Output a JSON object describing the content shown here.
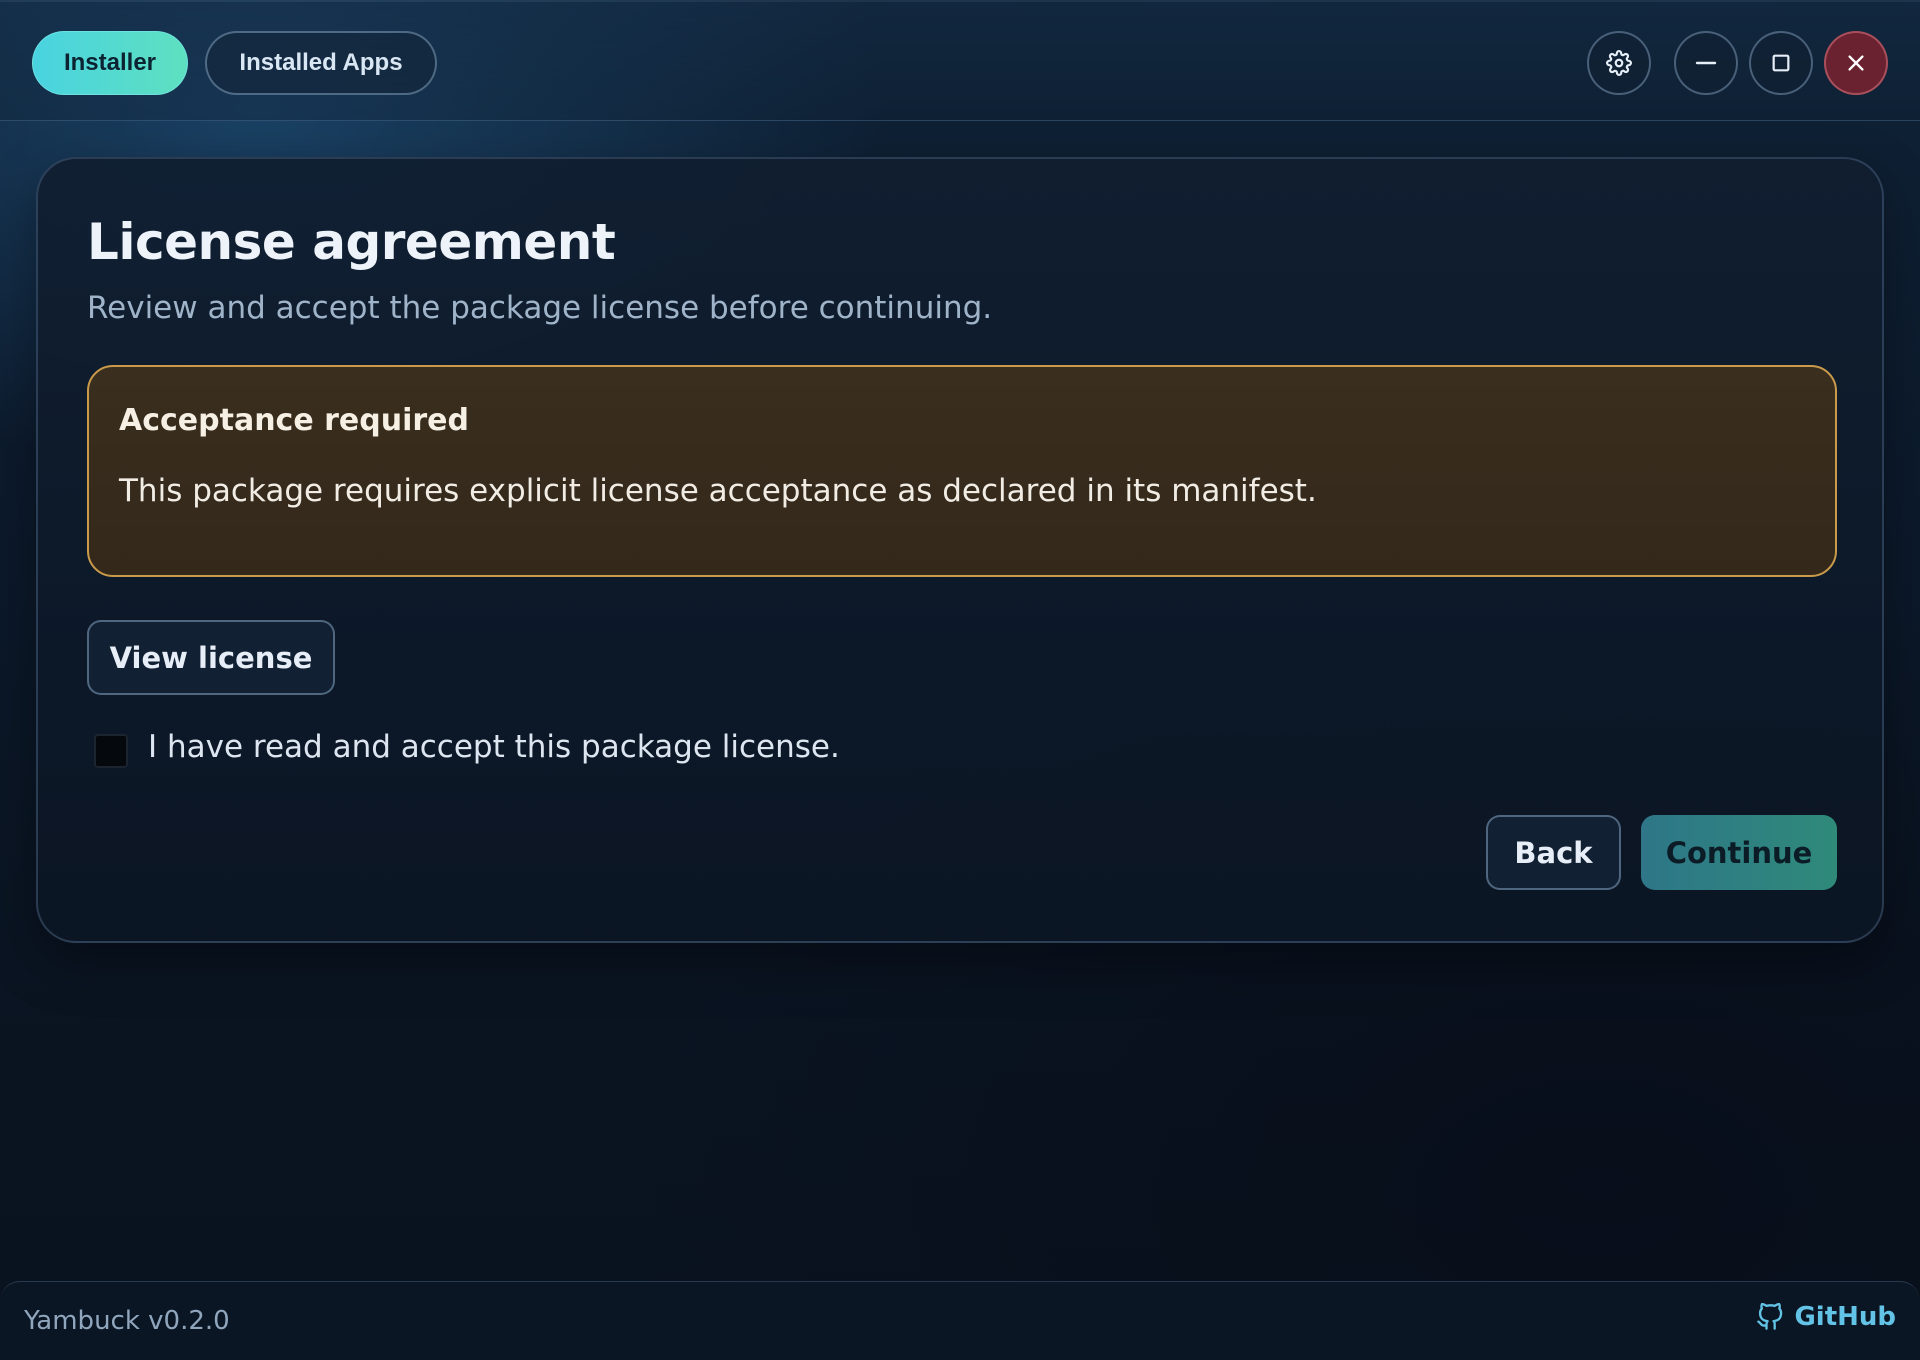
{
  "tabs": {
    "installer": "Installer",
    "installed_apps": "Installed Apps"
  },
  "window_controls": [
    "settings-icon",
    "minimize-icon",
    "maximize-icon",
    "close-icon"
  ],
  "page": {
    "title": "License agreement",
    "subtitle": "Review and accept the package license before continuing."
  },
  "notice": {
    "title": "Acceptance required",
    "text": "This package requires explicit license acceptance as declared in its manifest."
  },
  "actions": {
    "view_license": "View license",
    "accept_label": "I have read and accept this package license.",
    "accept_checked": false,
    "back": "Back",
    "continue": "Continue"
  },
  "footer": {
    "version": "Yambuck v0.2.0",
    "github": "GitHub"
  },
  "colors": {
    "accent": "#49d3e0",
    "warning_border": "#c99a4a",
    "close": "#6a2230",
    "link": "#63c3e6"
  }
}
